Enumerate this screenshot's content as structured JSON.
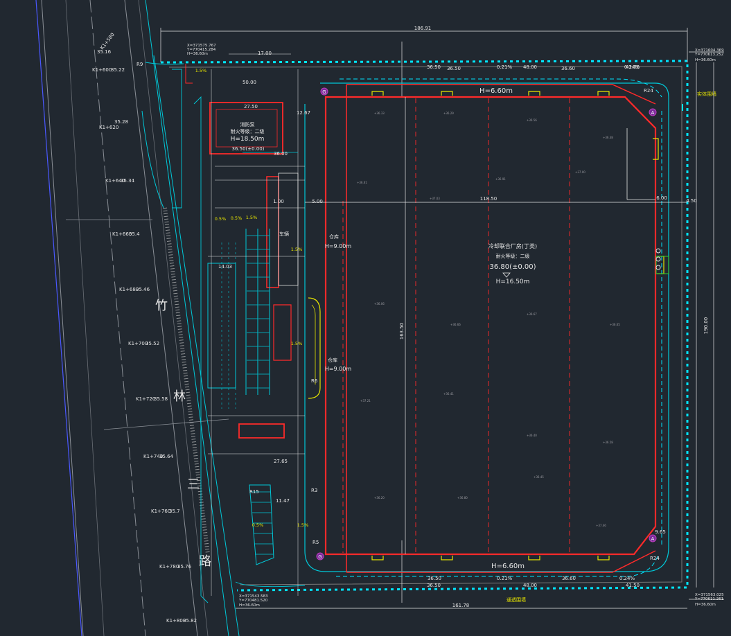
{
  "colors": {
    "background": "#212830",
    "building": "#ff2a2a",
    "road": "#00c8d8",
    "cyan_dash": "#00e5ff",
    "yellow": "#e8e600",
    "green": "#2fd02f",
    "white": "#e6e6e6",
    "magenta": "#c040c0",
    "blue": "#4a58ff"
  },
  "main_building": {
    "name": "冷却联合厂房(丁类)",
    "fire_rating": "耐火等级：二级",
    "elevation": "36.80(±0.00)",
    "height": "H=16.50m",
    "top_height": "H=6.60m",
    "bottom_height": "H=6.60m"
  },
  "pump_building": {
    "name": "消防泵",
    "fire_rating": "耐火等级：二级",
    "height": "H=18.50m",
    "elevation": "36.50(±0.00)"
  },
  "lane_labels": [
    "仓库",
    "H=9.00m",
    "H=9.00m",
    "仓库",
    "车辆"
  ],
  "road_name_chars": [
    "竹",
    "林",
    "三",
    "路"
  ],
  "fences": {
    "right": "实体围墙",
    "bottom": "通透围墙"
  },
  "dimensions": {
    "top_total": "186.91",
    "bottom_total": "161.78",
    "right_total": "190.00",
    "inner_width": "118.50",
    "inner_height": "163.50",
    "d_1700": "17.00",
    "d_5000": "50.00",
    "d_3650": "36.50",
    "d_4800": "48.00",
    "d_4150": "41.50",
    "d_2750": "27.50",
    "d_600": "6.00",
    "d_450": "4.50"
  },
  "chainages": [
    {
      "station": "K1+580",
      "level": "35.16"
    },
    {
      "station": "K1+600",
      "level": "35.22"
    },
    {
      "station": "K1+620",
      "level": "35.28"
    },
    {
      "station": "K1+640",
      "level": "35.34"
    },
    {
      "station": "K1+660",
      "level": "35.4"
    },
    {
      "station": "K1+680",
      "level": "35.46"
    },
    {
      "station": "K1+700",
      "level": "35.52"
    },
    {
      "station": "K1+720",
      "level": "35.58"
    },
    {
      "station": "K1+740",
      "level": "35.64"
    },
    {
      "station": "K1+760",
      "level": "35.7"
    },
    {
      "station": "K1+780",
      "level": "35.76"
    },
    {
      "station": "K1+800",
      "level": "35.82"
    }
  ],
  "corner_coords": [
    {
      "x": "X=371575.767",
      "y": "Y=770415.284",
      "h": "H=36.60m"
    },
    {
      "x": "X=371604.369",
      "y": "Y=770613.252",
      "h": "H=36.60m"
    },
    {
      "x": "X=371563.025",
      "y": "Y=770611.261",
      "h": "H=36.60m"
    },
    {
      "x": "X=371543.583",
      "y": "Y=770481.520",
      "h": "H=36.60m"
    }
  ],
  "markers": [
    "G",
    "A",
    "A",
    "G"
  ],
  "slopes": [
    "0.5%",
    "1.5%",
    "0.5%",
    "1.5%",
    "1.5%",
    "1.5%",
    "0.5%",
    "1.5%"
  ],
  "misc_labels": {
    "r_labels": [
      "R9",
      "R5",
      "R6",
      "R3",
      "R15",
      "R24",
      "R24"
    ],
    "pct_top": "0.21%",
    "pct_bottom": "0.21%",
    "pct_top_r": "0.24%",
    "pct_bot_r": "0.24%",
    "lv_top": "36.50",
    "lv_top2": "36.60",
    "lv_bot": "36.50",
    "lv_bot2": "36.60",
    "d_1": "1.00",
    "d_2": "5.00",
    "d_3": "36.00",
    "d_4": "12.67",
    "d_5": "14.03",
    "d_6": "11.47",
    "d_7": "27.65",
    "d_8": "9.65"
  }
}
